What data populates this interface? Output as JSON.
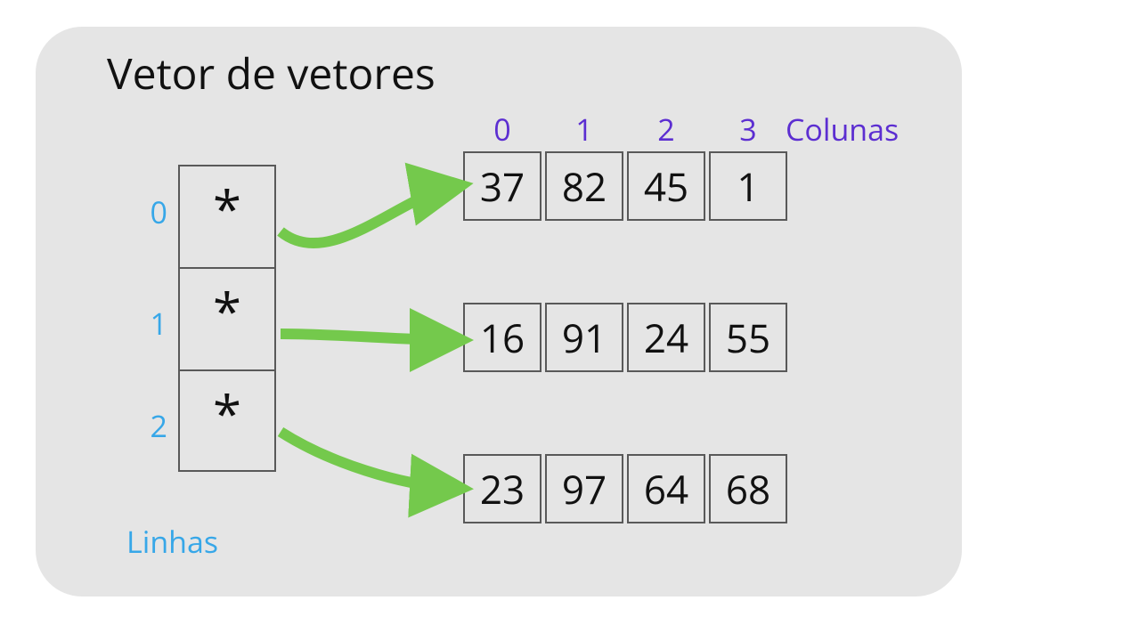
{
  "title": "Vetor de vetores",
  "columns_label": "Colunas",
  "rows_label": "Linhas",
  "column_indices": [
    "0",
    "1",
    "2",
    "3"
  ],
  "row_indices": [
    "0",
    "1",
    "2"
  ],
  "pointer_symbol": "*",
  "matrix": [
    [
      "37",
      "82",
      "45",
      "1"
    ],
    [
      "16",
      "91",
      "24",
      "55"
    ],
    [
      "23",
      "97",
      "64",
      "68"
    ]
  ],
  "colors": {
    "panel_bg": "#e5e5e5",
    "column_index": "#5c2ed1",
    "row_index": "#37a7e8",
    "arrow": "#74c94c",
    "cell_border": "#595959"
  }
}
